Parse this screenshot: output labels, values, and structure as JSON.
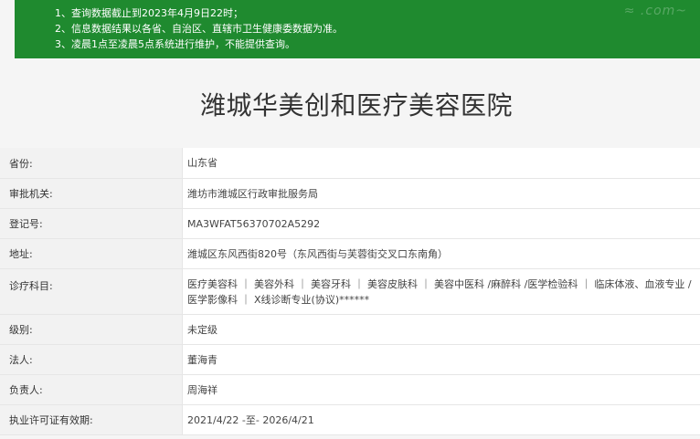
{
  "notice": {
    "lines": [
      "1、查询数据截止到2023年4月9日22时；",
      "2、信息数据结果以各省、自治区、直辖市卫生健康委数据为准。",
      "3、凌晨1点至凌晨5点系统进行维护，不能提供查询。"
    ],
    "watermark": "≈ .com~"
  },
  "title": "潍城华美创和医疗美容医院",
  "details": {
    "province": {
      "label": "省份:",
      "value": "山东省"
    },
    "authority": {
      "label": "审批机关:",
      "value": "潍坊市潍城区行政审批服务局"
    },
    "reg_no": {
      "label": "登记号:",
      "value": "MA3WFAT56370702A5292"
    },
    "address": {
      "label": "地址:",
      "value": "潍城区东风西街820号（东风西街与芙蓉街交叉口东南角）"
    },
    "subjects": {
      "label": "诊疗科目:",
      "value": "医疗美容科 ｜ 美容外科 ｜ 美容牙科 ｜ 美容皮肤科 ｜ 美容中医科 /麻醉科 /医学检验科 ｜ 临床体液、血液专业 / 医学影像科 ｜ X线诊断专业(协议)******"
    },
    "level": {
      "label": "级别:",
      "value": "未定级"
    },
    "legal_person": {
      "label": "法人:",
      "value": "董海青"
    },
    "person_in_charge": {
      "label": "负责人:",
      "value": "周海祥"
    },
    "license_validity": {
      "label": "执业许可证有效期:",
      "value": "2021/4/22 -至- 2026/4/21"
    }
  }
}
